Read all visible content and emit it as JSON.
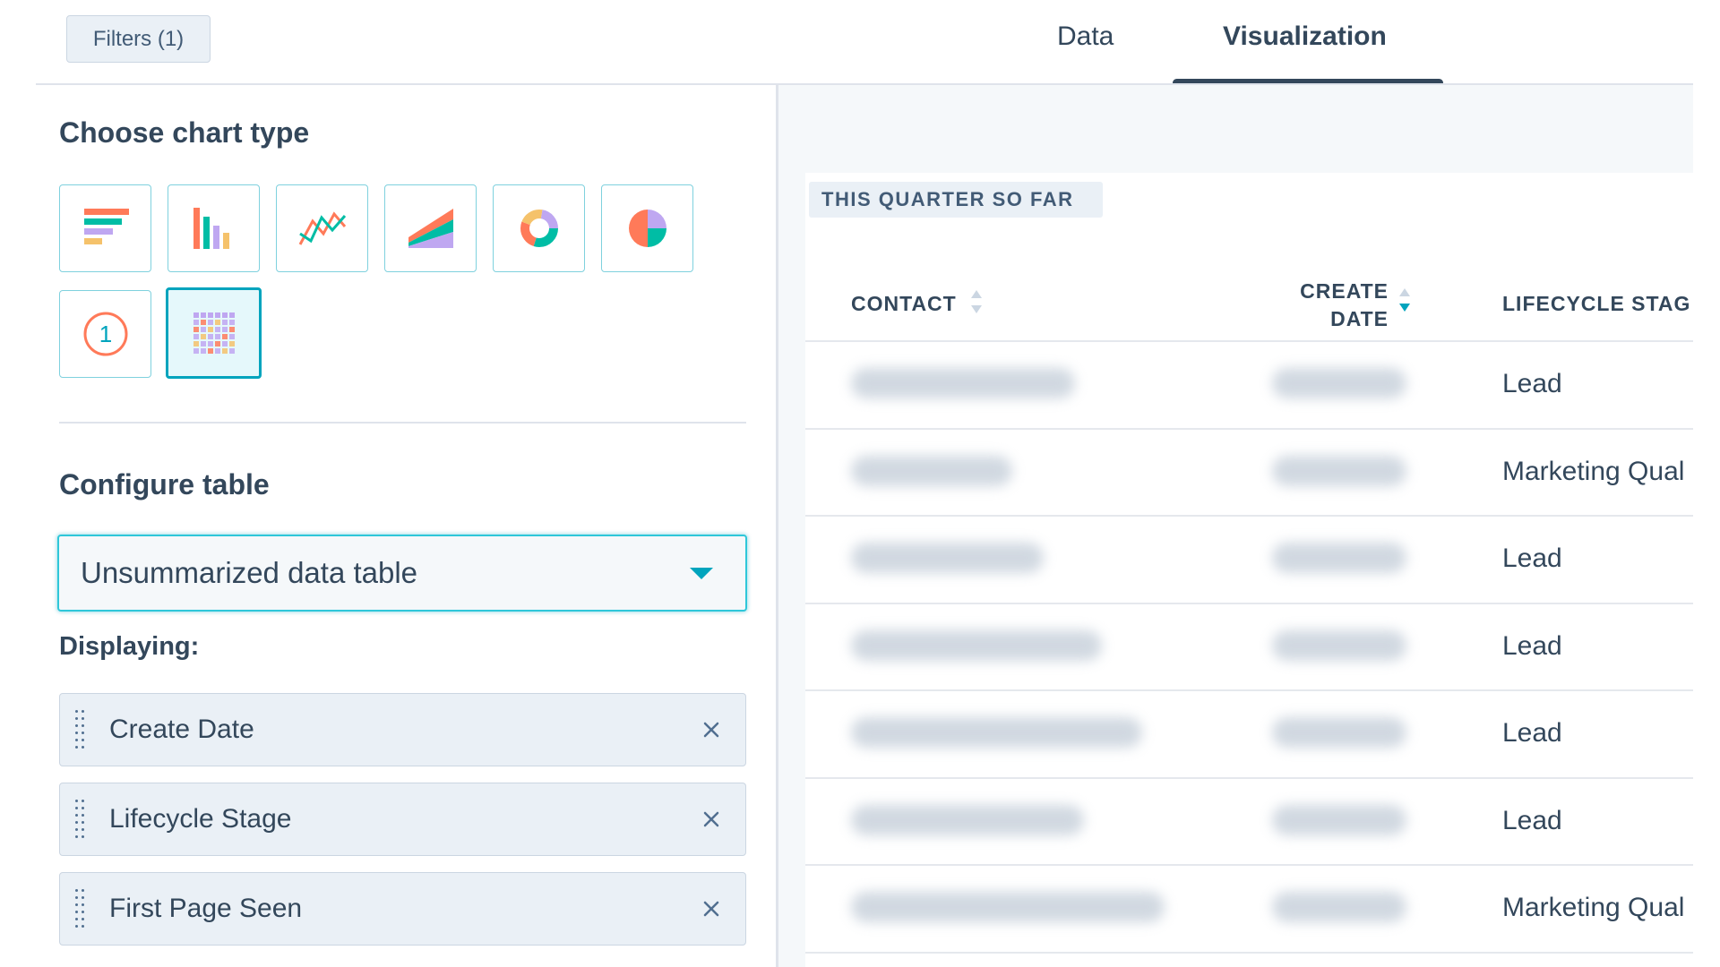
{
  "header": {
    "filters_label": "Filters (1)",
    "tabs": [
      {
        "label": "Data",
        "active": false
      },
      {
        "label": "Visualization",
        "active": true
      }
    ]
  },
  "chart_type_section": {
    "title": "Choose chart type",
    "types": [
      {
        "icon": "horizontal-bar-chart-icon",
        "selected": false
      },
      {
        "icon": "vertical-bar-chart-icon",
        "selected": false
      },
      {
        "icon": "line-chart-icon",
        "selected": false
      },
      {
        "icon": "area-chart-icon",
        "selected": false
      },
      {
        "icon": "donut-chart-icon",
        "selected": false
      },
      {
        "icon": "pie-chart-icon",
        "selected": false
      },
      {
        "icon": "summary-number-icon",
        "label": "1",
        "selected": false
      },
      {
        "icon": "data-table-icon",
        "selected": true
      }
    ]
  },
  "configure_section": {
    "title": "Configure table",
    "table_type_value": "Unsummarized data table",
    "displaying_label": "Displaying:",
    "fields": [
      {
        "label": "Create Date"
      },
      {
        "label": "Lifecycle Stage"
      },
      {
        "label": "First Page Seen"
      }
    ]
  },
  "preview": {
    "period_label": "THIS QUARTER SO FAR",
    "columns": {
      "contact": "CONTACT",
      "create_date_line1": "CREATE",
      "create_date_line2": "DATE",
      "lifecycle_stage": "LIFECYCLE STAG"
    },
    "sorted_column": "create_date",
    "sort_direction": "descending",
    "rows": [
      {
        "lifecycle_stage": "Lead"
      },
      {
        "lifecycle_stage": "Marketing Qual"
      },
      {
        "lifecycle_stage": "Lead"
      },
      {
        "lifecycle_stage": "Lead"
      },
      {
        "lifecycle_stage": "Lead"
      },
      {
        "lifecycle_stage": "Lead"
      },
      {
        "lifecycle_stage": "Marketing Qual"
      }
    ]
  },
  "colors": {
    "accent": "#00a4bd",
    "text": "#33475b",
    "selected_tile_bg": "#e5f8fb",
    "field_bg": "#eaf0f6"
  }
}
